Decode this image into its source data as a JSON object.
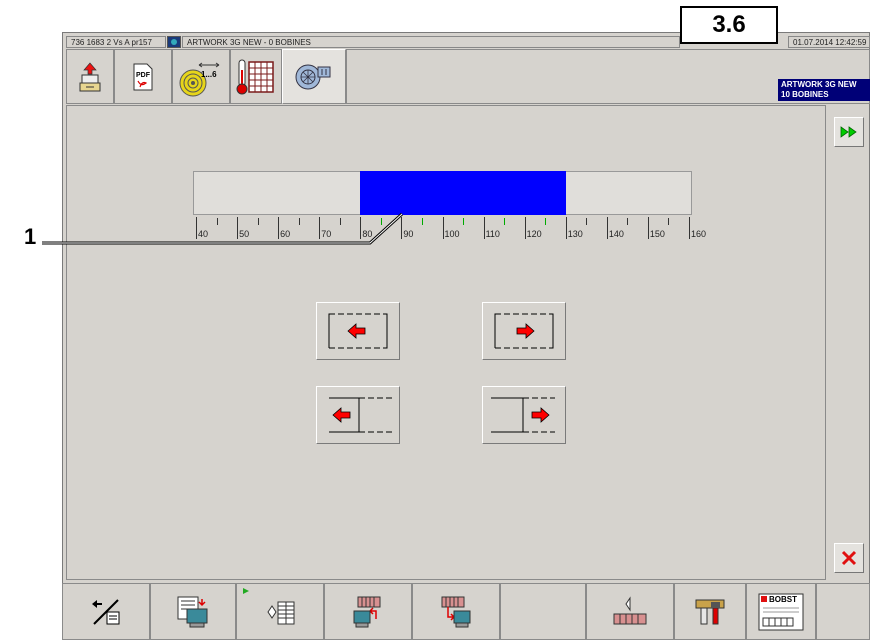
{
  "header": {
    "machine_info": "736 1683 2 Vs A pr157",
    "job_title": "ARTWORK 3G NEW - 0 BOBINES",
    "datetime": "01.07.2014 12:42:59",
    "version": "3.6"
  },
  "toolbar": {
    "items": [
      {
        "icon": "unload-icon"
      },
      {
        "icon": "pdf-icon"
      },
      {
        "icon": "bobbin-1-6-icon"
      },
      {
        "icon": "temperature-grid-icon"
      },
      {
        "icon": "fan-icon"
      }
    ],
    "badge_line1": "ARTWORK 3G NEW",
    "badge_line2": "10 BOBINES"
  },
  "gauge": {
    "ticks": [
      "40",
      "50",
      "60",
      "70",
      "80",
      "90",
      "100",
      "110",
      "120",
      "130",
      "140",
      "150",
      "160"
    ],
    "range_min": 40,
    "range_max": 160,
    "selected_from": 80,
    "selected_to": 130,
    "bar_color": "#0000ff"
  },
  "callout": {
    "number": "1"
  },
  "controls": {
    "shift_left_icon": "arrow-left-icon",
    "shift_right_icon": "arrow-right-icon",
    "contract_left_icon": "arrow-left-edge-icon",
    "expand_right_icon": "arrow-right-edge-icon",
    "forward_icon": "fast-forward-icon",
    "close_icon": "close-icon"
  },
  "bottombar": {
    "items": [
      {
        "icon": "swap-print-icon"
      },
      {
        "icon": "monitor-list-icon"
      },
      {
        "icon": "diamond-table-icon"
      },
      {
        "icon": "monitor-upload-icon"
      },
      {
        "icon": "monitor-download-icon"
      },
      {
        "icon": "level-icon"
      },
      {
        "icon": "tools-icon"
      },
      {
        "icon": "bobst-logo-icon",
        "label": "BOBST"
      }
    ]
  },
  "colors": {
    "accent_red": "#ff0000",
    "badge_bg": "#000077",
    "arrow_green": "#00aa00"
  }
}
